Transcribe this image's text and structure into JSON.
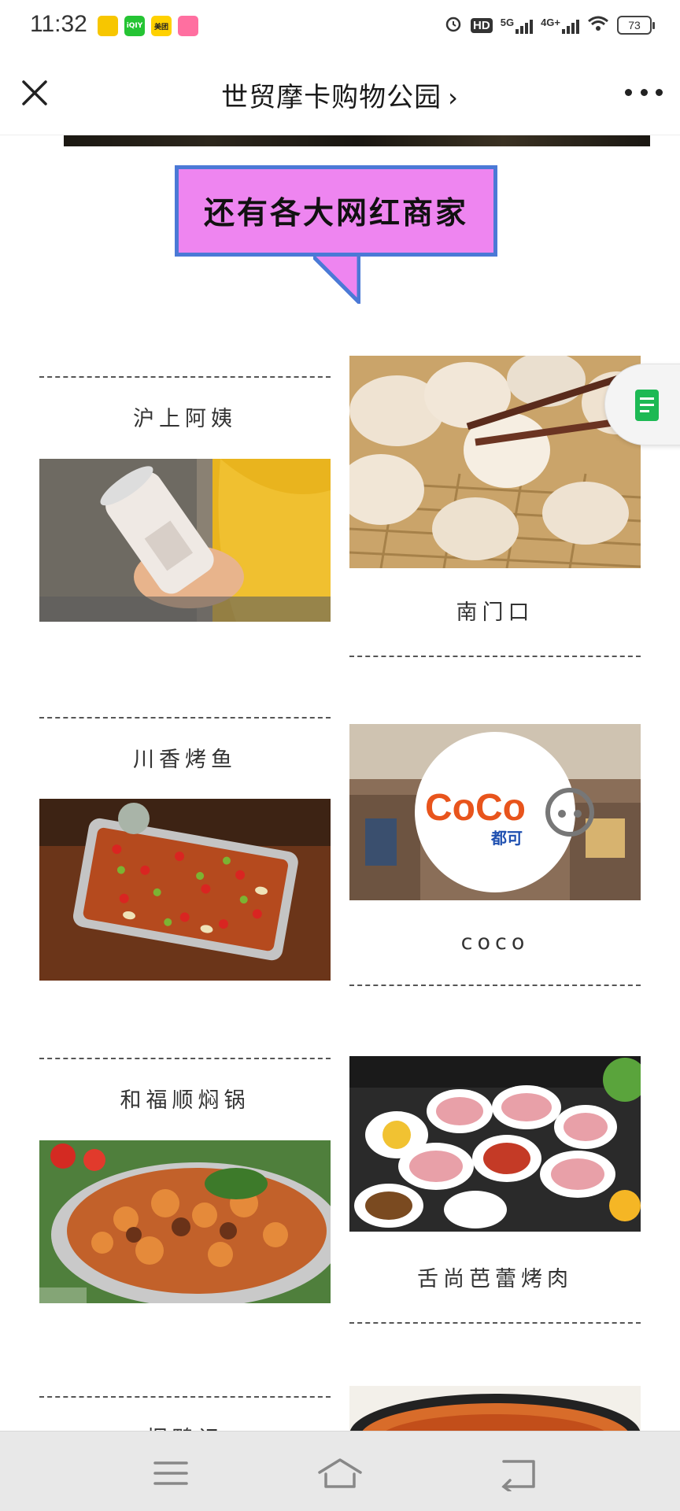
{
  "status_bar": {
    "time": "11:32",
    "app_icons": [
      "app-icon-1",
      "iqiyi-icon",
      "meituan-icon",
      "app-icon-4"
    ],
    "app_labels": [
      "",
      "iQIY",
      "美团",
      ""
    ],
    "network_hd": "HD",
    "network_5g": "5G",
    "network_4g": "4G+",
    "battery": "73"
  },
  "navbar": {
    "title": "世贸摩卡购物公园",
    "chevron": "›"
  },
  "banner": {
    "text": "还有各大网红商家"
  },
  "merchants": [
    {
      "name": "沪上阿姨",
      "image": "milk-tea-cup-photo"
    },
    {
      "name": "南门口",
      "image": "soup-dumplings-photo"
    },
    {
      "name": "川香烤鱼",
      "image": "grilled-fish-photo"
    },
    {
      "name": "coco",
      "image": "coco-logo-photo",
      "logo_text": "CoCo",
      "logo_sub": "都可"
    },
    {
      "name": "和福顺焖锅",
      "image": "braised-pot-photo"
    },
    {
      "name": "舌尚芭蕾烤肉",
      "image": "bbq-meat-photo"
    },
    {
      "name": "烟鸭记",
      "image": "soup-bowl-photo"
    }
  ],
  "colors": {
    "banner_bg": "#ee85f0",
    "banner_border": "#4b79d6",
    "float_icon": "#1db954"
  }
}
